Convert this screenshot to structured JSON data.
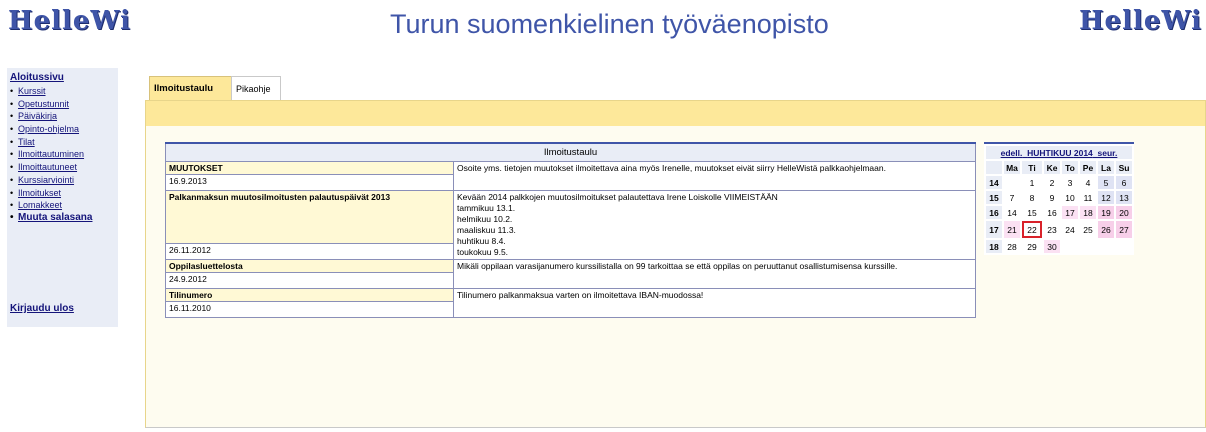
{
  "header": {
    "logo_left": "HelleWi",
    "title": "Turun suomenkielinen työväenopisto",
    "logo_right": "HelleWi"
  },
  "sidebar": {
    "home": "Aloitussivu",
    "items": [
      {
        "label": "Kurssit",
        "bold": false
      },
      {
        "label": "Opetustunnit",
        "bold": false
      },
      {
        "label": "Päiväkirja",
        "bold": false
      },
      {
        "label": "Opinto-ohjelma",
        "bold": false
      },
      {
        "label": "Tilat",
        "bold": false
      },
      {
        "label": "Ilmoittautuminen",
        "bold": false
      },
      {
        "label": "Ilmoittautuneet",
        "bold": false
      },
      {
        "label": "Kurssiarviointi",
        "bold": false
      },
      {
        "label": "Ilmoitukset",
        "bold": false
      },
      {
        "label": "Lomakkeet",
        "bold": false
      },
      {
        "label": "Muuta salasana",
        "bold": true
      }
    ],
    "logout": "Kirjaudu ulos"
  },
  "tabs": [
    {
      "label": "Ilmoitustaulu",
      "active": true
    },
    {
      "label": "Pikaohje",
      "active": false
    }
  ],
  "notice_board": {
    "title": "Ilmoitustaulu",
    "entries": [
      {
        "heading": "MUUTOKSET",
        "date": "16.9.2013",
        "text_lines": [
          "Osoite yms. tietojen muutokset ilmoitettava aina myös Irenelle, muutokset eivät siirry HelleWistä palkkaohjelmaan."
        ]
      },
      {
        "heading": "Palkanmaksun muutosilmoitusten palautuspäivät 2013",
        "date": "26.11.2012",
        "text_lines": [
          "Kevään 2014 palkkojen muutosilmoitukset palautettava Irene Loiskolle VIIMEISTÄÄN",
          "",
          "tammikuu 13.1.",
          "helmikuu 10.2.",
          "maaliskuu 11.3.",
          "huhtikuu 8.4.",
          "toukokuu 9.5."
        ]
      },
      {
        "heading": "Oppilasluettelosta",
        "date": "24.9.2012",
        "text_lines": [
          "Mikäli oppilaan varasijanumero kurssilistalla on 99 tarkoittaa se että oppilas on peruuttanut osallistumisensa kurssille."
        ]
      },
      {
        "heading": "Tilinumero",
        "date": "16.11.2010",
        "text_lines": [
          "Tilinumero palkanmaksua varten on ilmoitettava IBAN-muodossa!"
        ]
      }
    ]
  },
  "calendar": {
    "prev": "edell.",
    "month": "HUHTIKUU",
    "year": "2014",
    "next": "seur.",
    "weekdays": [
      "Ma",
      "Ti",
      "Ke",
      "To",
      "Pe",
      "La",
      "Su"
    ],
    "weeks": [
      {
        "week": "14",
        "days": [
          "",
          "1",
          "2",
          "3",
          "4",
          "5",
          "6"
        ]
      },
      {
        "week": "15",
        "days": [
          "7",
          "8",
          "9",
          "10",
          "11",
          "12",
          "13"
        ]
      },
      {
        "week": "16",
        "days": [
          "14",
          "15",
          "16",
          "17",
          "18",
          "19",
          "20"
        ]
      },
      {
        "week": "17",
        "days": [
          "21",
          "22",
          "23",
          "24",
          "25",
          "26",
          "27"
        ]
      },
      {
        "week": "18",
        "days": [
          "28",
          "29",
          "30",
          "",
          "",
          "",
          ""
        ]
      }
    ],
    "today": "22",
    "highlighted_days": [
      "17",
      "18",
      "19",
      "20",
      "21",
      "26",
      "27",
      "30"
    ]
  }
}
